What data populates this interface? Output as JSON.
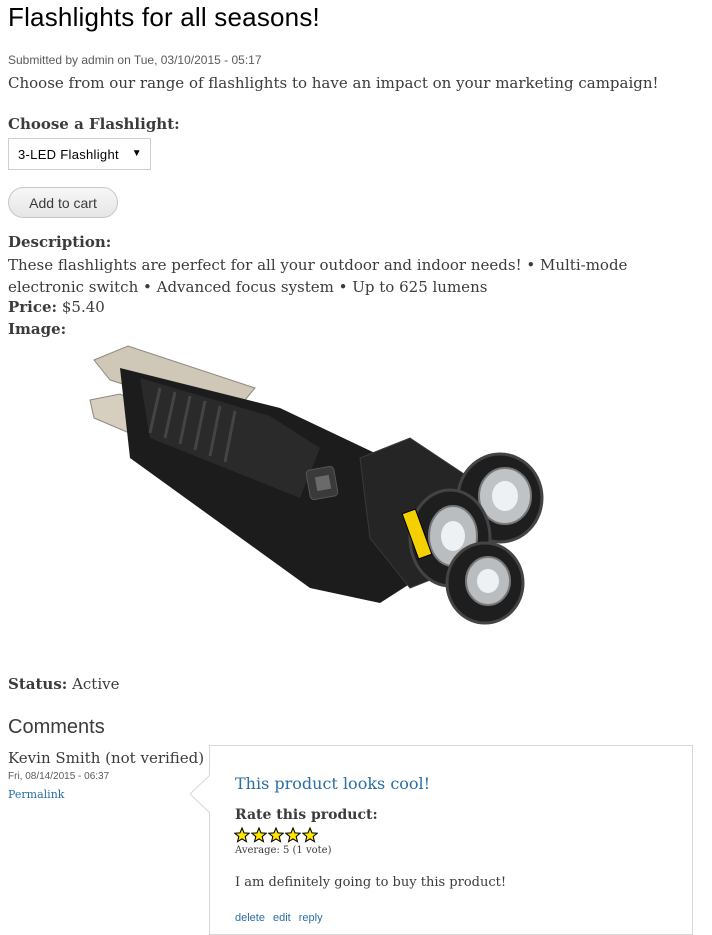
{
  "page": {
    "title": "Flashlights for all seasons!",
    "submitted": "Submitted by admin on Tue, 03/10/2015 - 05:17",
    "intro": "Choose from our range of flashlights to have an impact on your marketing campaign!"
  },
  "form": {
    "choose_label": "Choose a Flashlight:",
    "selected_option": "3-LED Flashlight",
    "add_to_cart": "Add to cart"
  },
  "fields": {
    "description_label": "Description:",
    "description_text": "These flashlights are perfect for all your outdoor and indoor needs! • Multi-mode electronic switch • Advanced focus system • Up to 625 lumens",
    "price_label": "Price:",
    "price_value": "$5.40",
    "image_label": "Image:",
    "status_label": "Status:",
    "status_value": "Active"
  },
  "comments": {
    "heading": "Comments",
    "items": [
      {
        "author": "Kevin Smith (not verified)",
        "date": "Fri, 08/14/2015 - 06:37",
        "permalink": "Permalink",
        "subject": "This product looks cool!",
        "rate_label": "Rate this product:",
        "rating": 5,
        "average": "Average: 5 (1 vote)",
        "body": "I am definitely going to buy this product!",
        "links": {
          "delete": "delete",
          "edit": "edit",
          "reply": "reply"
        }
      }
    ]
  },
  "colors": {
    "link": "#2a6ea5",
    "star_fill": "#ffe600",
    "flashlight_body": "#1c1c1c",
    "flashlight_accent": "#f5d000"
  }
}
